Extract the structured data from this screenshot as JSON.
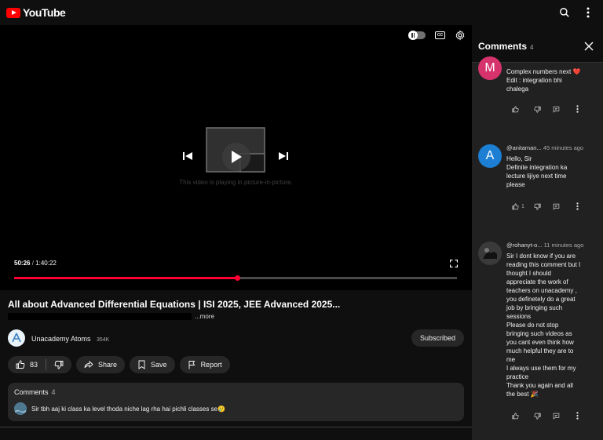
{
  "header": {
    "logo_text": "YouTube"
  },
  "player": {
    "pip_message": "This video is playing in picture-in-picture.",
    "current_time": "50:26",
    "separator": "/",
    "duration": "1:40:22",
    "progress_fraction": 0.503,
    "cc_label": "CC"
  },
  "video": {
    "title": "All about Advanced Differential Equations | ISI 2025, JEE Advanced 2025...",
    "more_label": "...more",
    "channel_name": "Unacademy Atoms",
    "subscriber_count": "354K",
    "subscribed_label": "Subscribed",
    "like_count": "83",
    "share_label": "Share",
    "save_label": "Save",
    "report_label": "Report"
  },
  "comments_card": {
    "heading": "Comments",
    "count": "4",
    "preview_text": "Sir tbh aaj ki class ka level thoda niche lag rha hai pichli classes se🥲"
  },
  "panel": {
    "title": "Comments",
    "count": "4",
    "comments": [
      {
        "avatar_letter": "M",
        "avatar_color": "#d6336c",
        "author": "",
        "time": "",
        "text_lines": [
          "Complex numbers next ❤️",
          "Edit : integration bhi",
          "chalega"
        ],
        "likes": ""
      },
      {
        "avatar_letter": "A",
        "avatar_color": "#1c7fd4",
        "author": "@anitaman...",
        "time": "45 minutes ago",
        "text_lines": [
          "Hello, Sir",
          "Definite integration ka",
          "lecture lijiye next time",
          "please"
        ],
        "likes": "1"
      },
      {
        "avatar_letter": "",
        "avatar_color": "#2b2b2b",
        "author": "@rohanyt-o...",
        "time": "11 minutes ago",
        "text_lines": [
          "Sir I dont know if you are",
          "reading this comment but I",
          "thought I should",
          "appreciate the work of",
          "teachers on unacademy ,",
          "you definetely do a great",
          "job by bringing such",
          "sessions",
          "Please do not stop",
          "bringing such videos as",
          "you cant even think how",
          "much helpful they are to",
          "me",
          "I always use them for my",
          "practice",
          "Thank you again and all",
          "the best 🎉"
        ],
        "likes": ""
      }
    ]
  }
}
